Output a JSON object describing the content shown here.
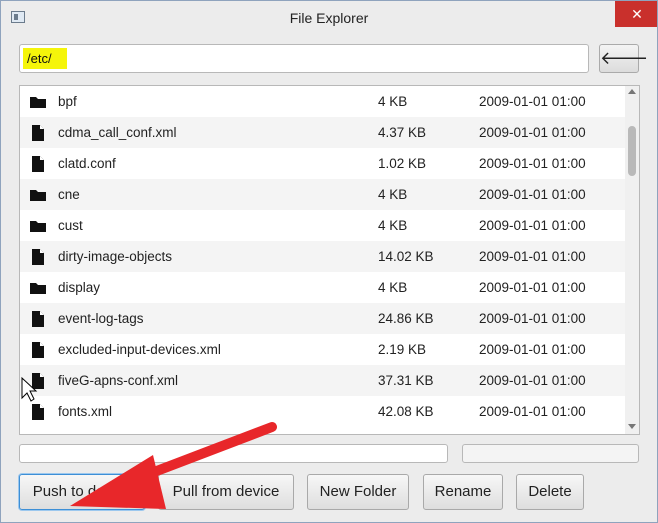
{
  "window": {
    "title": "File Explorer",
    "close_label": "✕",
    "accent_close": "#c9302c",
    "highlight_color": "#f5f50a"
  },
  "path": {
    "value": "/etc/"
  },
  "back_button": {
    "label": "🡐"
  },
  "files": [
    {
      "type": "folder",
      "name": "bpf",
      "size": "4 KB",
      "date": "2009-01-01 01:00"
    },
    {
      "type": "file",
      "name": "cdma_call_conf.xml",
      "size": "4.37 KB",
      "date": "2009-01-01 01:00"
    },
    {
      "type": "file",
      "name": "clatd.conf",
      "size": "1.02 KB",
      "date": "2009-01-01 01:00"
    },
    {
      "type": "folder",
      "name": "cne",
      "size": "4 KB",
      "date": "2009-01-01 01:00"
    },
    {
      "type": "folder",
      "name": "cust",
      "size": "4 KB",
      "date": "2009-01-01 01:00"
    },
    {
      "type": "file",
      "name": "dirty-image-objects",
      "size": "14.02 KB",
      "date": "2009-01-01 01:00"
    },
    {
      "type": "folder",
      "name": "display",
      "size": "4 KB",
      "date": "2009-01-01 01:00"
    },
    {
      "type": "file",
      "name": "event-log-tags",
      "size": "24.86 KB",
      "date": "2009-01-01 01:00"
    },
    {
      "type": "file",
      "name": "excluded-input-devices.xml",
      "size": "2.19 KB",
      "date": "2009-01-01 01:00"
    },
    {
      "type": "file",
      "name": "fiveG-apns-conf.xml",
      "size": "37.31 KB",
      "date": "2009-01-01 01:00"
    },
    {
      "type": "file",
      "name": "fonts.xml",
      "size": "42.08 KB",
      "date": "2009-01-01 01:00"
    }
  ],
  "buttons": {
    "push": "Push to device",
    "pull": "Pull from device",
    "new_folder": "New Folder",
    "rename": "Rename",
    "delete": "Delete"
  },
  "annotation": {
    "arrow_color": "#e8272a"
  }
}
